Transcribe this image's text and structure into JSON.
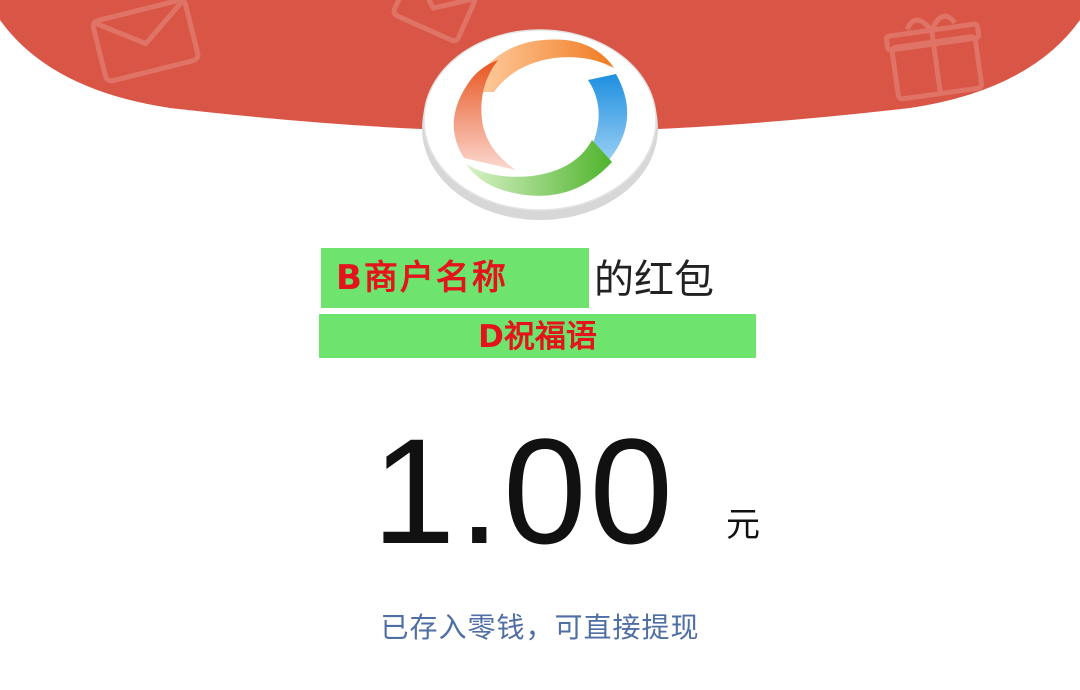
{
  "packet": {
    "merchant_name": "B商户名称",
    "title_suffix": "的红包",
    "blessing": "D祝福语",
    "amount": "1.00",
    "unit": "元",
    "notice": "已存入零钱，可直接提现"
  },
  "colors": {
    "header_red": "#d95546",
    "highlight_green": "#6ee46f",
    "placeholder_text_red": "#e3141b",
    "notice_blue": "#4e6ea4"
  },
  "icons": {
    "header_decorations": [
      "envelope-icon",
      "gift-icon"
    ],
    "logo": "swirl-logo"
  }
}
